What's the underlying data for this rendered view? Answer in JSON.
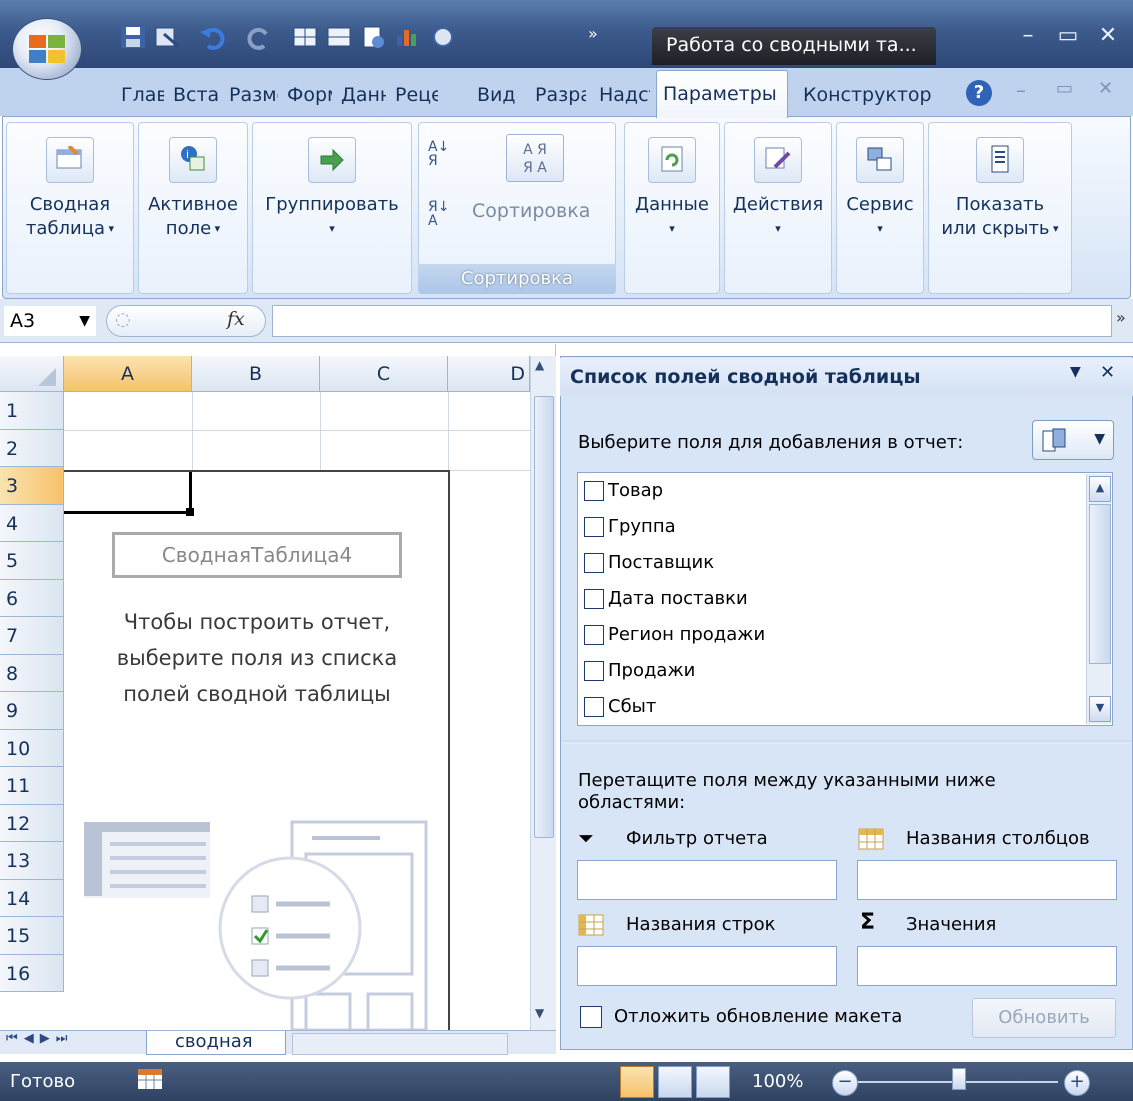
{
  "window": {
    "context_tab_title": "Работа со сводными та...",
    "minimize_glyph": "–",
    "maximize_glyph": "▭",
    "close_glyph": "✕"
  },
  "ribbon_tabs": [
    {
      "label": "Главная"
    },
    {
      "label": "Вставка"
    },
    {
      "label": "Разметка страницы"
    },
    {
      "label": "Формулы"
    },
    {
      "label": "Данные"
    },
    {
      "label": "Рецензирование"
    },
    {
      "label": "Вид"
    },
    {
      "label": "Разработчик"
    },
    {
      "label": "Надстройки"
    },
    {
      "label": "Параметры",
      "active": true
    },
    {
      "label": "Конструктор"
    }
  ],
  "ribbon": {
    "pivot_table": {
      "line1": "Сводная",
      "line2": "таблица",
      "icon": "pivot-table-icon"
    },
    "active_field": {
      "line1": "Активное",
      "line2": "поле",
      "icon": "active-field-icon"
    },
    "group": {
      "label": "Группировать",
      "icon": "group-arrow-icon"
    },
    "sort_az_glyph": "А↓Я",
    "sort_za_glyph": "Я↓А",
    "sort_btn_label": "Сортировка",
    "sort_group_label": "Сортировка",
    "data": {
      "label": "Данные",
      "icon": "data-refresh-icon"
    },
    "actions": {
      "label": "Действия",
      "icon": "actions-icon"
    },
    "tools": {
      "label": "Сервис",
      "icon": "tools-icon"
    },
    "show_hide": {
      "line1": "Показать",
      "line2": "или скрыть",
      "icon": "show-hide-icon"
    }
  },
  "formula_bar": {
    "name_box": "A3",
    "fx_label": "fx"
  },
  "grid": {
    "columns": [
      "A",
      "B",
      "C",
      "D"
    ],
    "rows": [
      "1",
      "2",
      "3",
      "4",
      "5",
      "6",
      "7",
      "8",
      "9",
      "10",
      "11",
      "12",
      "13",
      "14",
      "15",
      "16"
    ],
    "pivot_name": "СводнаяТаблица4",
    "pivot_hint": "Чтобы построить отчет, выберите поля из списка полей сводной таблицы"
  },
  "sheet_tabs": {
    "active_sheet": "сводная"
  },
  "field_pane": {
    "title": "Список полей сводной таблицы",
    "choose_label": "Выберите поля для добавления в отчет:",
    "fields": [
      "Товар",
      "Группа",
      "Поставщик",
      "Дата поставки",
      "Регион продажи",
      "Продажи",
      "Сбыт"
    ],
    "drag_label": "Перетащите поля между указанными ниже областями:",
    "areas": {
      "report_filter": "Фильтр отчета",
      "column_labels": "Названия столбцов",
      "row_labels": "Названия строк",
      "values": "Значения",
      "sigma_glyph": "Σ"
    },
    "defer_label": "Отложить обновление макета",
    "update_button": "Обновить"
  },
  "status_bar": {
    "ready": "Готово",
    "zoom": "100%"
  },
  "colors": {
    "accent_orange": "#f6c26b",
    "pane_bg": "#d8e5f6",
    "tab_row_bg": "#bfd3ee"
  }
}
